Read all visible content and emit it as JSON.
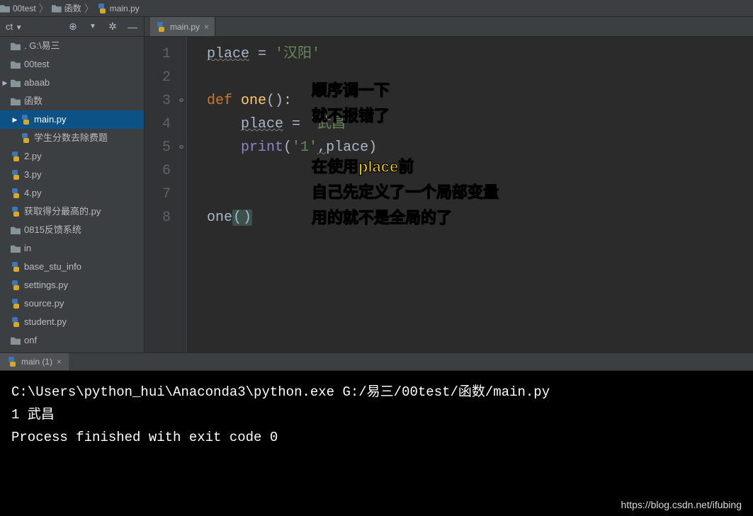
{
  "breadcrumb": [
    {
      "icon": "folder",
      "label": "00test"
    },
    {
      "icon": "folder",
      "label": "函数"
    },
    {
      "icon": "python",
      "label": "main.py"
    }
  ],
  "sidebar": {
    "dropdown_label": "ct",
    "tree": [
      {
        "depth": 1,
        "tri": "",
        "icon": "folder",
        "label": ". G:\\易三",
        "name": "tree-root"
      },
      {
        "depth": 1,
        "tri": "",
        "icon": "folder",
        "label": "00test",
        "name": "tree-00test"
      },
      {
        "depth": 1,
        "tri": "▶",
        "icon": "folder",
        "label": "abaab",
        "name": "tree-abaab"
      },
      {
        "depth": 1,
        "tri": "",
        "icon": "folder",
        "label": "函数",
        "name": "tree-hanshu"
      },
      {
        "depth": 2,
        "tri": "▶",
        "icon": "python",
        "label": "main.py",
        "name": "tree-main-py",
        "selected": true
      },
      {
        "depth": 2,
        "tri": "",
        "icon": "python",
        "label": "学生分数去除费题",
        "name": "tree-xuesheng"
      },
      {
        "depth": 1,
        "tri": "",
        "icon": "python",
        "label": "2.py",
        "name": "tree-2py"
      },
      {
        "depth": 1,
        "tri": "",
        "icon": "python",
        "label": "3.py",
        "name": "tree-3py"
      },
      {
        "depth": 1,
        "tri": "",
        "icon": "python",
        "label": "4.py",
        "name": "tree-4py"
      },
      {
        "depth": 1,
        "tri": "",
        "icon": "python",
        "label": "获取得分最高的.py",
        "name": "tree-huoqu"
      },
      {
        "depth": 1,
        "tri": "",
        "icon": "folder",
        "label": "0815反馈系统",
        "name": "tree-0815"
      },
      {
        "depth": 1,
        "tri": "",
        "icon": "folder",
        "label": "in",
        "name": "tree-in"
      },
      {
        "depth": 1,
        "tri": "",
        "icon": "python",
        "label": "base_stu_info",
        "name": "tree-base"
      },
      {
        "depth": 1,
        "tri": "",
        "icon": "python",
        "label": "settings.py",
        "name": "tree-settings"
      },
      {
        "depth": 1,
        "tri": "",
        "icon": "python",
        "label": "source.py",
        "name": "tree-source"
      },
      {
        "depth": 1,
        "tri": "",
        "icon": "python",
        "label": "student.py",
        "name": "tree-student"
      },
      {
        "depth": 1,
        "tri": "",
        "icon": "folder",
        "label": "onf",
        "name": "tree-onf"
      }
    ]
  },
  "editor": {
    "tab": {
      "label": "main.py"
    },
    "line_numbers": [
      "1",
      "2",
      "3",
      "4",
      "5",
      "6",
      "7",
      "8"
    ],
    "code": {
      "l1_var": "place",
      "l1_eq": " = ",
      "l1_str": "'汉阳'",
      "l3_def": "def ",
      "l3_fn": "one",
      "l3_paren": "():",
      "l4_indent": "    ",
      "l4_var": "place",
      "l4_eq": " = ",
      "l4_str": "'武昌'",
      "l5_indent": "    ",
      "l5_print": "print",
      "l5_open": "(",
      "l5_arg1": "'1'",
      "l5_comma": ",",
      "l5_arg2": "place",
      "l5_close": ")",
      "l8_call": "one",
      "l8_open": "(",
      "l8_close": ")"
    }
  },
  "annotation": {
    "line1": "顺序调一下",
    "line2": "就不报错了",
    "line3": "在使用place前",
    "line4": "自己先定义了一个局部变量",
    "line5": "用的就不是全局的了"
  },
  "console": {
    "tab_label": "main (1)",
    "line1": "C:\\Users\\python_hui\\Anaconda3\\python.exe G:/易三/00test/函数/main.py",
    "line2": "1 武昌",
    "line3": "",
    "line4": "Process finished with exit code 0"
  },
  "watermark": "https://blog.csdn.net/ifubing"
}
